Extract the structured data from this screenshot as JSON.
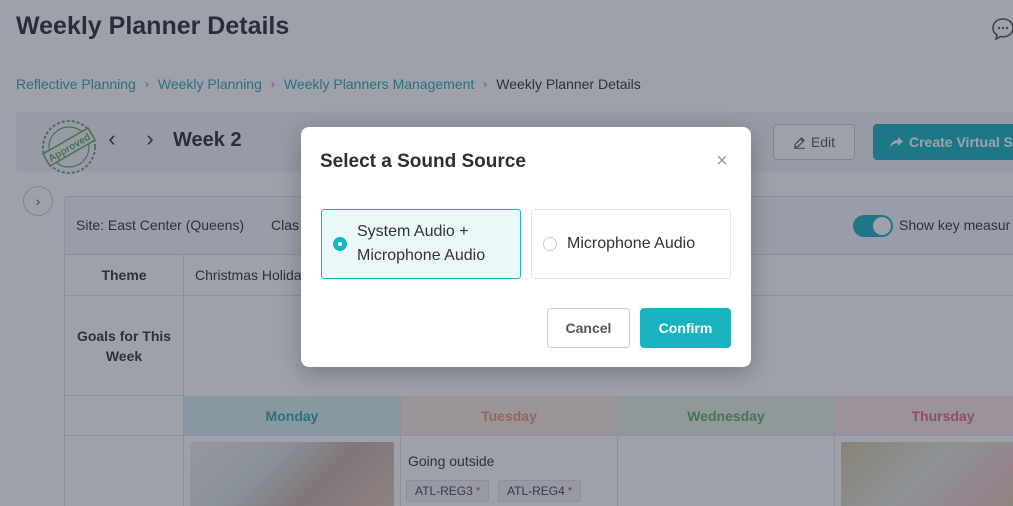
{
  "page": {
    "title": "Weekly Planner Details"
  },
  "breadcrumb": [
    {
      "label": "Reflective Planning",
      "link": true
    },
    {
      "label": "Weekly Planning",
      "link": true
    },
    {
      "label": "Weekly Planners Management",
      "link": true
    },
    {
      "label": "Weekly Planner Details",
      "link": false
    }
  ],
  "week_bar": {
    "stamp_text": "Approved",
    "week_label": "Week 2",
    "edit_label": "Edit",
    "create_label": "Create Virtual S"
  },
  "info_row": {
    "site": "Site: East Center (Queens)",
    "class": "Clas",
    "toggle_label": "Show key measur",
    "toggle_on": true
  },
  "table": {
    "theme_label": "Theme",
    "theme_value": "Christmas Holida",
    "goals_label": "Goals for This Week",
    "days": [
      "Monday",
      "Tuesday",
      "Wednesday",
      "Thursday"
    ],
    "tuesday_activity": "Going outside",
    "tuesday_tags": [
      "ATL-REG3",
      "ATL-REG4"
    ],
    "tag_marker": "*"
  },
  "modal": {
    "title": "Select a Sound Source",
    "options": [
      {
        "label": "System Audio + Microphone Audio",
        "selected": true
      },
      {
        "label": "Microphone Audio",
        "selected": false
      }
    ],
    "cancel_label": "Cancel",
    "confirm_label": "Confirm"
  },
  "colors": {
    "accent": "#17b3bf",
    "link": "#2aa7b2",
    "overlay": "#282e42",
    "monday": "#2aa7b2",
    "tuesday": "#e49a6c",
    "wednesday": "#5fae6a",
    "thursday": "#e06a77"
  },
  "icons": {
    "chat": "chat-bubble-icon",
    "edit": "pencil-icon",
    "create": "share-arrow-icon",
    "prev": "chevron-left-icon",
    "next": "chevron-right-icon",
    "expand": "chevron-right-icon",
    "close": "close-icon"
  }
}
